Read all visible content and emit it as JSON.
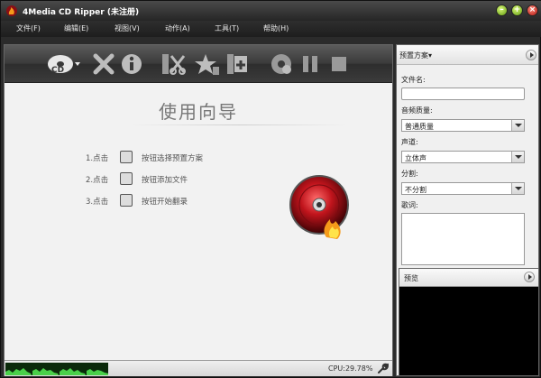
{
  "window": {
    "title": "4Media CD Ripper (未注册)"
  },
  "menu": [
    {
      "label": "文件(F)"
    },
    {
      "label": "编辑(E)"
    },
    {
      "label": "视图(V)"
    },
    {
      "label": "动作(A)"
    },
    {
      "label": "工具(T)"
    },
    {
      "label": "帮助(H)"
    }
  ],
  "toolbar": {
    "icons": [
      "cd-load-icon",
      "delete-icon",
      "info-icon",
      "cut-icon",
      "effects-icon",
      "add-files-icon",
      "convert-icon",
      "pause-icon",
      "stop-icon"
    ]
  },
  "guide": {
    "title": "使用向导",
    "steps": [
      {
        "num": "1.点击",
        "text": "按钮选择预置方案"
      },
      {
        "num": "2.点击",
        "text": "按钮添加文件"
      },
      {
        "num": "3.点击",
        "text": "按钮开始翻录"
      }
    ]
  },
  "status": {
    "cpu": "CPU:29.78%"
  },
  "settings": {
    "preset_label": "预置方案▾",
    "filename_label": "文件名:",
    "filename_value": "",
    "quality_label": "音频质量:",
    "quality_value": "普通质量",
    "channel_label": "声道:",
    "channel_value": "立体声",
    "split_label": "分割:",
    "split_value": "不分割",
    "lyrics_label": "歌词:"
  },
  "preview": {
    "label": "预览"
  },
  "colors": {
    "accent_red": "#c0141c",
    "flame": "#f59a1a",
    "spectrum": "#4ad04a"
  }
}
